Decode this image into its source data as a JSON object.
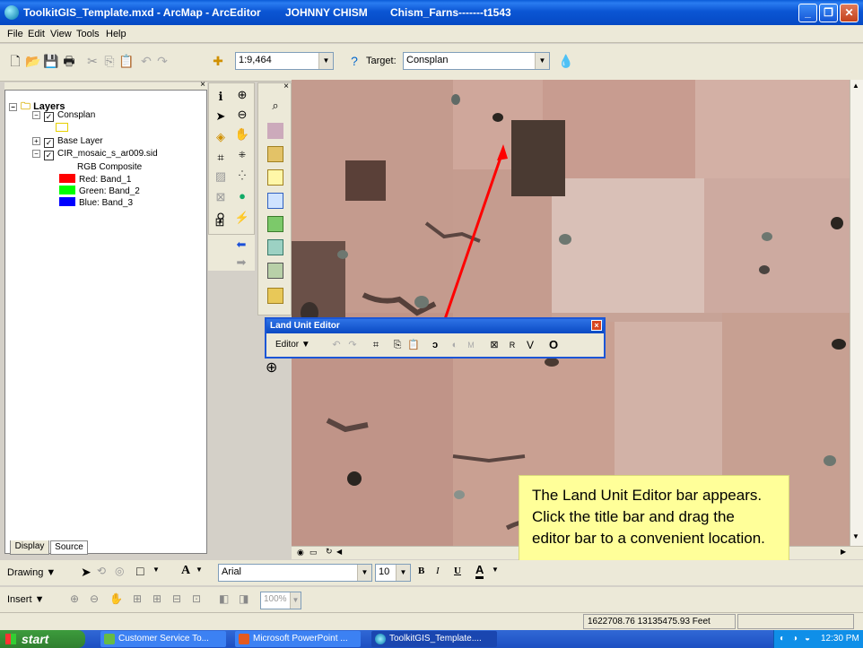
{
  "window": {
    "title": "ToolkitGIS_Template.mxd - ArcMap - ArcEditor",
    "user": "JOHNNY CHISM",
    "farm": "Chism_Farns-------t1543"
  },
  "menu": {
    "file": "File",
    "edit": "Edit",
    "view": "View",
    "tools": "Tools",
    "help": "Help"
  },
  "standard_toolbar": {
    "scale": "1:9,464",
    "target_label": "Target:",
    "target_value": "Consplan"
  },
  "toc": {
    "root": "Layers",
    "consplan": "Consplan",
    "base_layer": "Base Layer",
    "cir_mosaic": "CIR_mosaic_s_ar009.sid",
    "rgb": "RGB Composite",
    "red": "Red:   Band_1",
    "green": "Green: Band_2",
    "blue": "Blue:  Band_3",
    "tab_display": "Display",
    "tab_source": "Source"
  },
  "land_unit_editor": {
    "title": "Land Unit Editor",
    "editor_menu": "Editor",
    "btn_m": "M",
    "btn_r": "R",
    "btn_v": "V"
  },
  "callout": {
    "text": "The Land Unit Editor bar appears. Click the title bar and drag the editor bar to a convenient location."
  },
  "drawing_toolbar": {
    "drawing": "Drawing",
    "font": "Arial",
    "size": "10",
    "bold": "B",
    "italic": "I",
    "underline": "U",
    "font_color": "A"
  },
  "insert_toolbar": {
    "insert": "Insert",
    "zoom": "100%"
  },
  "status": {
    "coords": "1622708.76  13135475.93 Feet"
  },
  "taskbar": {
    "start": "start",
    "task1": "Customer Service To...",
    "task2": "Microsoft PowerPoint ...",
    "task3": "ToolkitGIS_Template....",
    "clock": "12:30 PM"
  },
  "colors": {
    "title_blue": "#0b56d4",
    "callout_yellow": "#ffff99",
    "arrow_red": "#ff0000",
    "band_red": "#ff0000",
    "band_green": "#00ff00",
    "band_blue": "#0000ff"
  }
}
